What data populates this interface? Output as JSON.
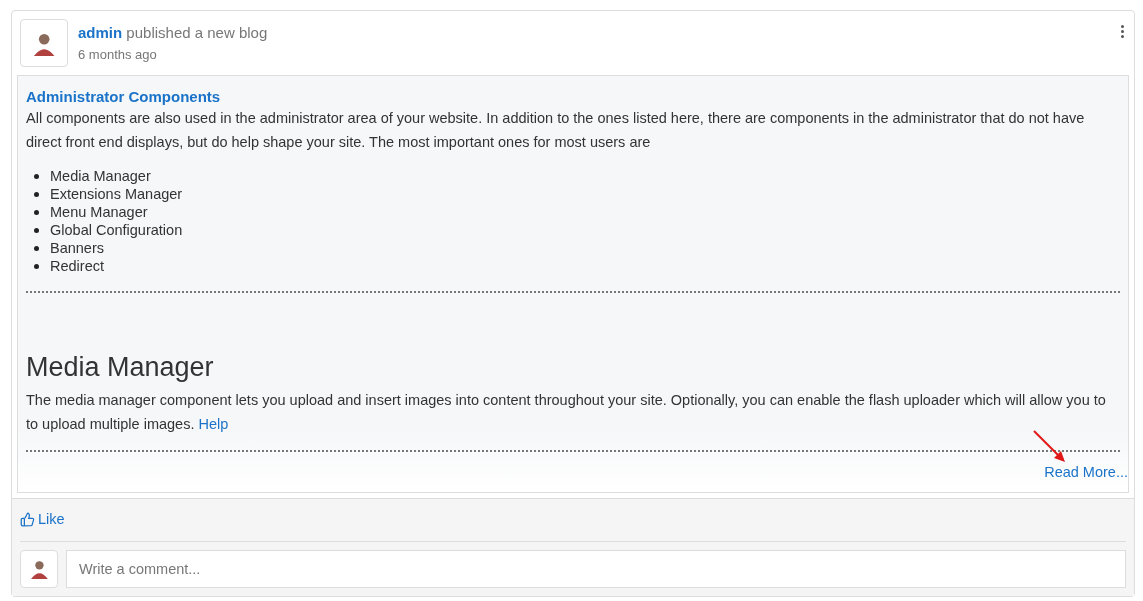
{
  "post": {
    "author": "admin",
    "action": "published a new blog",
    "time": "6 months ago"
  },
  "blog": {
    "title": "Administrator Components",
    "intro": "All components are also used in the administrator area of your website. In addition to the ones listed here, there are components in the administrator that do not have direct front end displays, but do help shape your site. The most important ones for most users are",
    "list": [
      "Media Manager",
      "Extensions Manager",
      "Menu Manager",
      "Global Configuration",
      "Banners",
      "Redirect"
    ],
    "heading": "Media Manager",
    "body": "The media manager component lets you upload and insert images into content throughout your site. Optionally, you can enable the flash uploader which will allow you to to upload multiple images.",
    "help_link": "Help",
    "read_more": "Read More..."
  },
  "actions": {
    "like": "Like"
  },
  "comment": {
    "placeholder": "Write a comment..."
  }
}
